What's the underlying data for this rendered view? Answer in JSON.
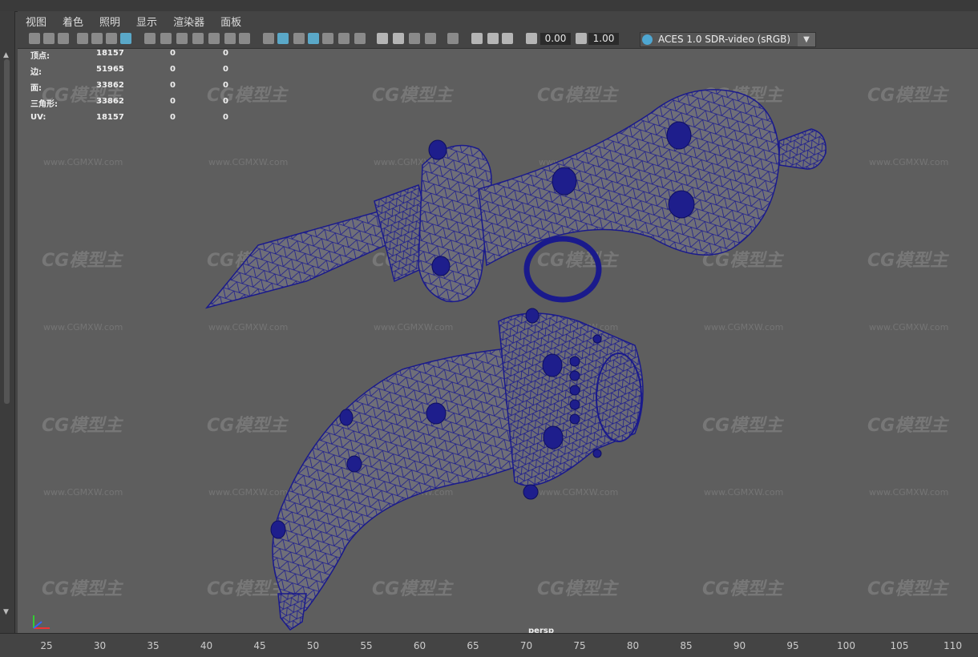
{
  "menu": [
    "视图",
    "着色",
    "照明",
    "显示",
    "渲染器",
    "面板"
  ],
  "toolbar": {
    "field1": "0.00",
    "field2": "1.00",
    "colorspace": "ACES 1.0 SDR-video (sRGB)",
    "dropdown": "▼"
  },
  "hud": {
    "rows": [
      {
        "label": "顶点:",
        "v1": "18157",
        "v2": "0",
        "v3": "0"
      },
      {
        "label": "边:",
        "v1": "51965",
        "v2": "0",
        "v3": "0"
      },
      {
        "label": "面:",
        "v1": "33862",
        "v2": "0",
        "v3": "0"
      },
      {
        "label": "三角形:",
        "v1": "33862",
        "v2": "0",
        "v3": "0"
      },
      {
        "label": "UV:",
        "v1": "18157",
        "v2": "0",
        "v3": "0"
      }
    ]
  },
  "watermark": {
    "logo": "CG模型主",
    "url": "www.CGMXW.com"
  },
  "camera": "persp",
  "ruler": [
    "25",
    "30",
    "35",
    "40",
    "45",
    "50",
    "55",
    "60",
    "65",
    "70",
    "75",
    "80",
    "85",
    "90",
    "95",
    "100",
    "105",
    "110"
  ],
  "colors": {
    "wire": "#1a1a8c",
    "surface": "#6e6e74",
    "accent": "#5aa8c8"
  }
}
